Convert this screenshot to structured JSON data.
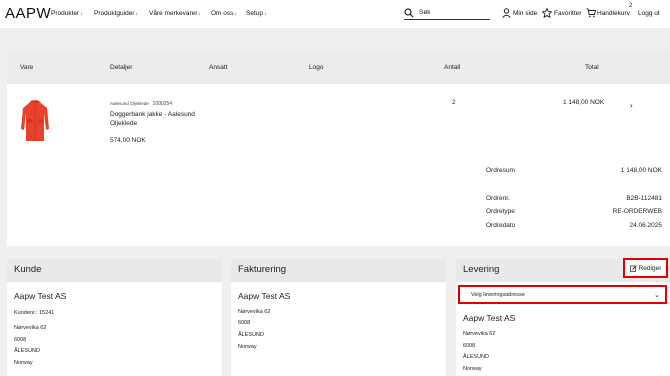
{
  "header": {
    "logo": "AAPW",
    "nav": [
      {
        "label": "Produkter"
      },
      {
        "label": "Produktguider"
      },
      {
        "label": "Våre merkevarer"
      },
      {
        "label": "Om oss"
      },
      {
        "label": "Setup"
      }
    ],
    "search_placeholder": "Søk",
    "my_page": "Min side",
    "favorites": "Favoritter",
    "cart": "Handlekurv",
    "cart_count": "2",
    "logout": "Logg ut"
  },
  "order_table": {
    "headers": {
      "item": "Vare",
      "details": "Detaljer",
      "employee": "Ansatt",
      "logo": "Logo",
      "quantity": "Antall",
      "total": "Total"
    },
    "row": {
      "brand": "Aalesund Oljeklede",
      "sku": "1000254",
      "name": "Doggerbank jakke - Aalesund Oljeklede",
      "unit_price": "574,00 NOK",
      "quantity": "2",
      "total": "1 148,00 NOK"
    },
    "summary": {
      "order_sum_label": "Ordresum",
      "order_sum_value": "1 148,00 NOK",
      "order_no_label": "Ordrenr.",
      "order_no_value": "B2B-112481",
      "order_type_label": "Ordretype",
      "order_type_value": "RE-ORDERWEB",
      "order_date_label": "Ordredato",
      "order_date_value": "24.06.2025"
    }
  },
  "customer": {
    "title": "Kunde",
    "name": "Aapw Test AS",
    "customer_no": "Kundenr.:  15241",
    "street": "Nørvevika 62",
    "zip": "6008",
    "city": "ÅLESUND",
    "country": "Norway"
  },
  "billing": {
    "title": "Fakturering",
    "name": "Aapw Test AS",
    "street": "Nørvevika 62",
    "zip": "6008",
    "city": "ÅLESUND",
    "country": "Norway"
  },
  "delivery": {
    "title": "Levering",
    "edit_label": "Rediger",
    "select_placeholder": "Velg leveringsadresse",
    "name": "Aapw Test AS",
    "street": "Nørvevika 62",
    "zip": "6008",
    "city": "ÅLESUND",
    "country": "Norway"
  },
  "colors": {
    "highlight": "#e00000",
    "jacket": "#e8412c"
  }
}
